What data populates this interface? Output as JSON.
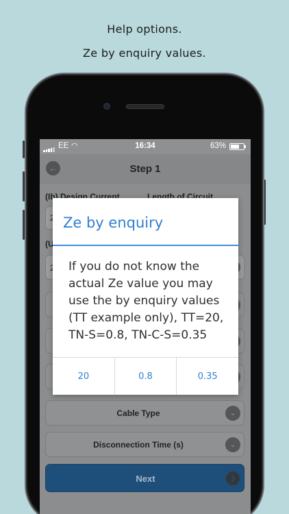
{
  "captions": [
    "Help options.",
    "Ze by enquiry values."
  ],
  "status_bar": {
    "carrier": "EE",
    "time": "16:34",
    "battery": "63%"
  },
  "nav": {
    "title": "Step 1",
    "back_icon": "back-arrow-icon"
  },
  "form": {
    "design_current_label": "(Ib) Design Current",
    "length_label": "Length of Circuit",
    "partial_field_value": "2",
    "partial_label": "(U",
    "cable_type_label": "Cable Type",
    "disconnection_label": "Disconnection Time (s)",
    "next_label": "Next"
  },
  "dialog": {
    "title": "Ze by enquiry",
    "message": "If you do not know the actual Ze value you may use the by enquiry values (TT example only), TT=20, TN-S=0.8, TN-C-S=0.35",
    "options": [
      "20",
      "0.8",
      "0.35"
    ]
  },
  "colors": {
    "accent": "#2f7fd2",
    "background": "#b9d9dc",
    "next_button": "#1e4f7a"
  }
}
